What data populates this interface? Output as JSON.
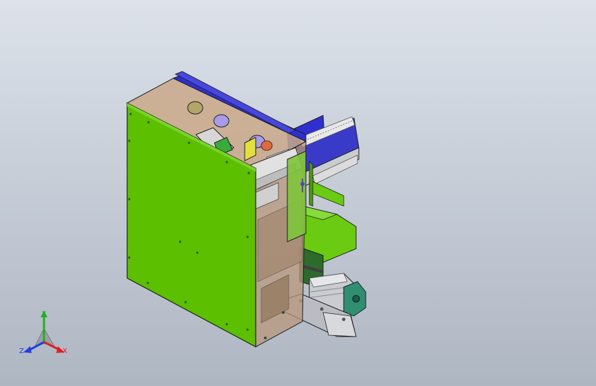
{
  "viewport": {
    "background_top": "#dde2ea",
    "background_bottom": "#aeb6c2"
  },
  "model": {
    "colors": {
      "front_panel": "#5cbf00",
      "top_panel": "#caa98a",
      "blue_frame": "#2f2fd0",
      "rail": "#9fa2d6",
      "cylinder": "#a99be8",
      "yellow_block": "#e2e03c",
      "motor": "#2f8f70",
      "steel": "#c9ccd1",
      "outline": "#1e1e1e"
    }
  },
  "triad": {
    "icon": "axis-triad-icon",
    "x_label": "X",
    "y_label": "Y",
    "z_label": "Z",
    "x_color": "#e02020",
    "y_color": "#20b020",
    "z_color": "#2040e0"
  }
}
